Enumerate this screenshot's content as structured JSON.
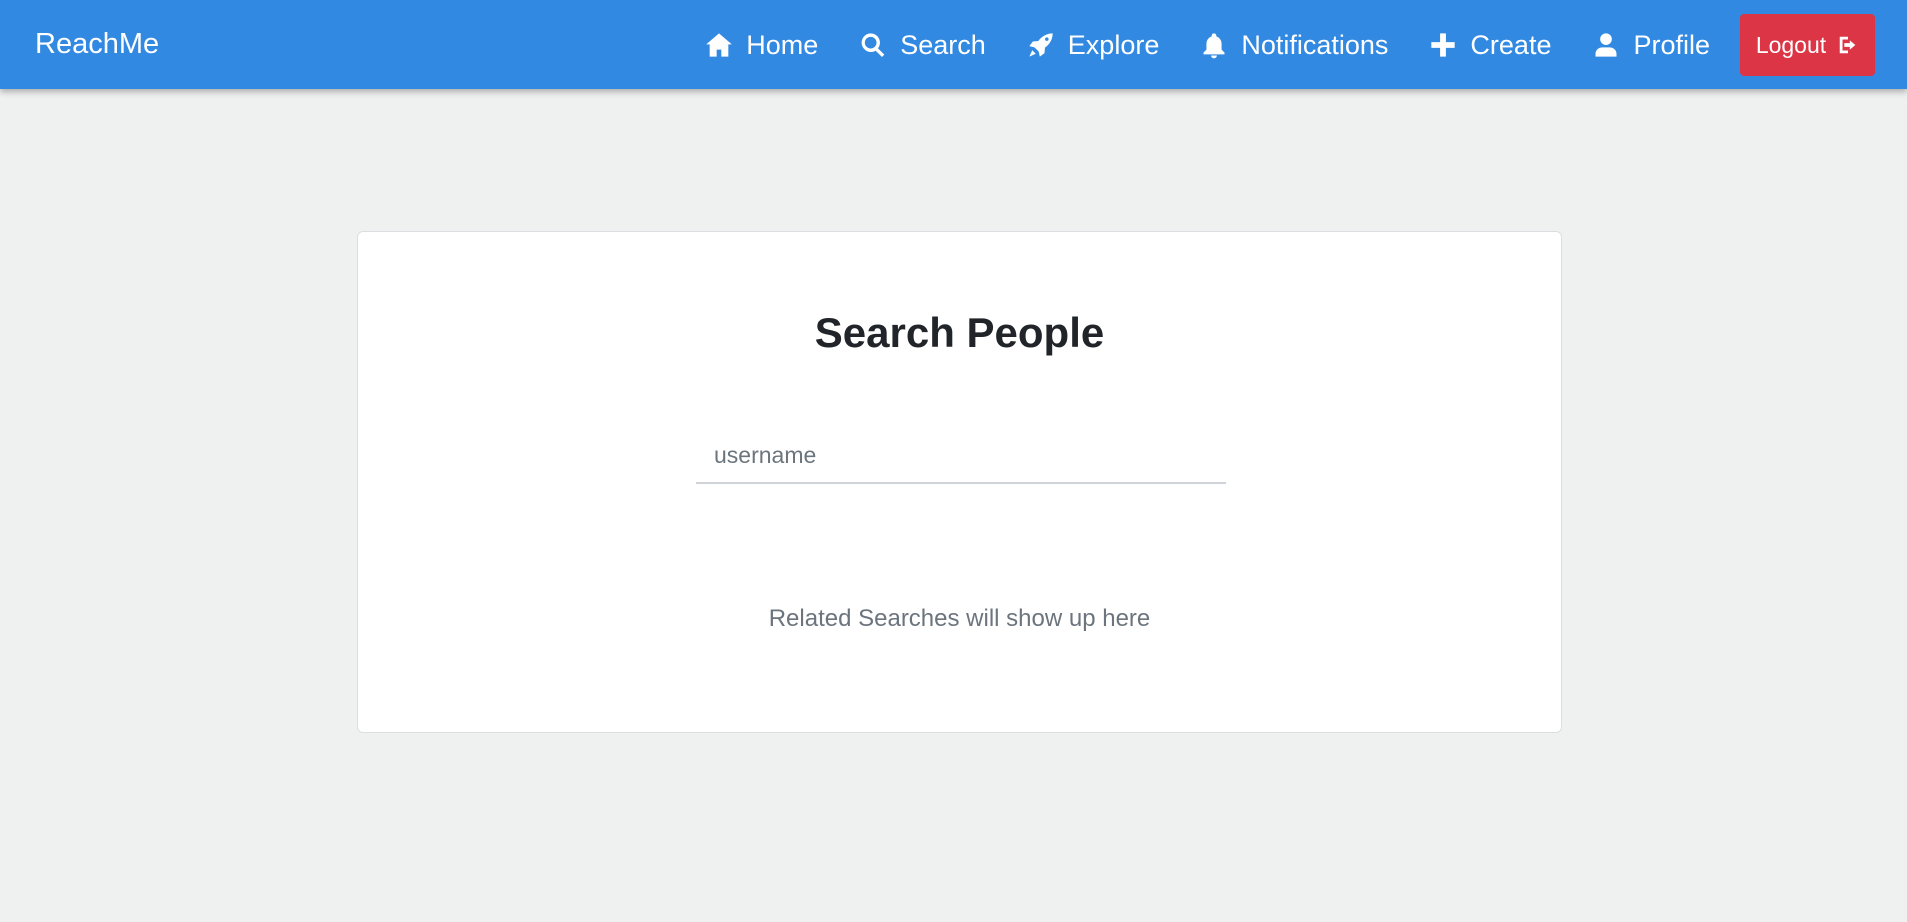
{
  "brand": "ReachMe",
  "nav": {
    "items": [
      {
        "label": "Home",
        "icon": "home-icon"
      },
      {
        "label": "Search",
        "icon": "search-icon"
      },
      {
        "label": "Explore",
        "icon": "rocket-icon"
      },
      {
        "label": "Notifications",
        "icon": "bell-icon"
      },
      {
        "label": "Create",
        "icon": "plus-icon"
      },
      {
        "label": "Profile",
        "icon": "user-icon"
      }
    ],
    "logout": {
      "label": "Logout",
      "icon": "sign-out-icon"
    }
  },
  "main": {
    "title": "Search People",
    "search": {
      "placeholder": "username",
      "value": ""
    },
    "hint": "Related Searches will show up here"
  },
  "colors": {
    "navbar": "#3289e2",
    "logout": "#dc3545",
    "background": "#eff1f0"
  }
}
